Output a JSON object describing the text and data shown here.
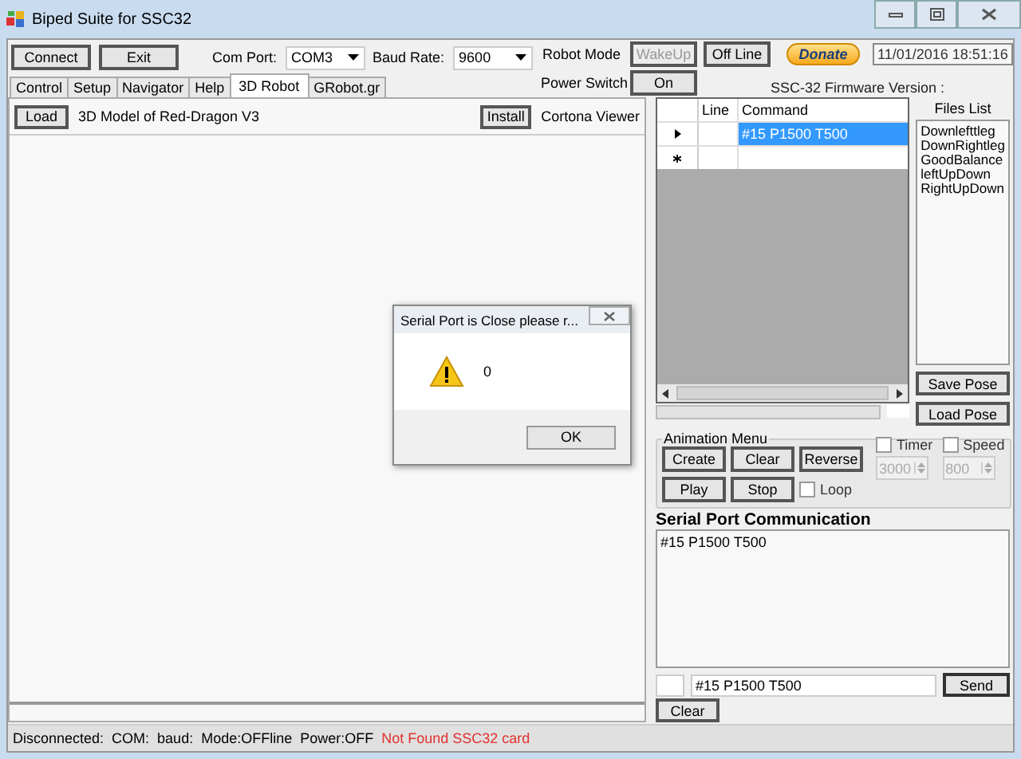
{
  "window": {
    "title": "Biped Suite for SSC32"
  },
  "top_bar": {
    "buttons": [
      "Connect",
      "Exit"
    ],
    "com_port": {
      "label": "Com Port:",
      "value": "COM3"
    },
    "baud_rate": {
      "label": "Baud Rate:",
      "value": "9600"
    },
    "robot_mode": {
      "label": "Robot Mode",
      "buttons": [
        {
          "label": "WakeUp",
          "disabled": true
        },
        {
          "label": "Off Line",
          "disabled": false
        }
      ]
    },
    "power_switch": {
      "label": "Power Switch",
      "button": "On"
    },
    "donate": "Donate",
    "datetime": "11/01/2016 18:51:16",
    "firmware_label": "SSC-32 Firmware Version :"
  },
  "tabs": [
    {
      "label": "Control",
      "selected": false
    },
    {
      "label": "Setup",
      "selected": false
    },
    {
      "label": "Navigator",
      "selected": false
    },
    {
      "label": "Help",
      "selected": false
    },
    {
      "label": "3D Robot",
      "selected": true
    },
    {
      "label": "GRobot.gr",
      "selected": false
    }
  ],
  "tab_panel": {
    "load_button": "Load",
    "model_label": "3D Model of Red-Dragon V3",
    "install_button": "Install",
    "viewer_label": "Cortona Viewer"
  },
  "dialog": {
    "title": "Serial Port is Close please r...",
    "message": "0",
    "button": "OK"
  },
  "command_grid": {
    "columns": [
      "Line",
      "Command"
    ],
    "rows": [
      {
        "kind": "current",
        "command": "#15 P1500 T500",
        "selected": true
      },
      {
        "kind": "new",
        "selected": false
      }
    ]
  },
  "progress": {
    "level": 0
  },
  "files_list": {
    "title": "Files List",
    "items": [
      "Downlefttleg",
      "DownRightleg",
      "GoodBalance",
      "leftUpDown",
      "RightUpDown"
    ]
  },
  "pose_buttons": [
    "Save Pose",
    "Load Pose"
  ],
  "animation_menu": {
    "title": "Animation Menu",
    "buttons": [
      "Create",
      "Clear",
      "Reverse",
      "Play",
      "Stop"
    ],
    "loop": {
      "label": "Loop",
      "checked": false
    },
    "timer": {
      "label": "Timer",
      "checked": false,
      "value": "3000"
    },
    "speed": {
      "label": "Speed",
      "checked": false,
      "value": "800"
    }
  },
  "serial": {
    "title": "Serial Port Communication",
    "log": "#15 P1500 T500",
    "input": "#15 P1500 T500",
    "send": "Send",
    "clear": "Clear"
  },
  "status_bar": [
    {
      "text": "Disconnected:",
      "alert": false
    },
    {
      "text": "COM:",
      "alert": false
    },
    {
      "text": "baud:",
      "alert": false
    },
    {
      "text": "Mode:OFFline",
      "alert": false
    },
    {
      "text": "Power:OFF",
      "alert": false
    },
    {
      "text": "Not Found SSC32 card",
      "alert": true
    }
  ]
}
